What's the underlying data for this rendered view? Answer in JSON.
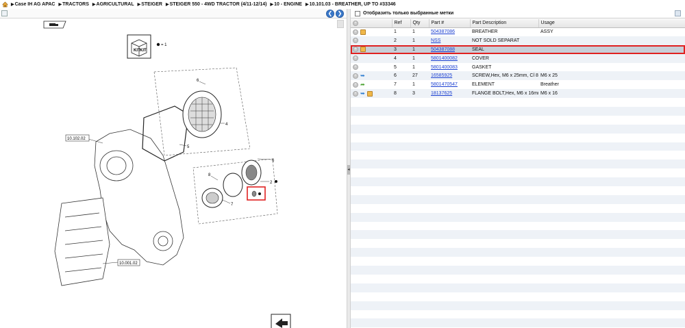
{
  "breadcrumb": {
    "items": [
      "Case IH AG APAC",
      "TRACTORS",
      "AGRICULTURAL",
      "STEIGER",
      "STEIGER 550 - 4WD TRACTOR (4/11-12/14)",
      "10 - ENGINE",
      "10.101.03 - BREATHER, UP TO #33346"
    ],
    "home_icon": "home-icon"
  },
  "diagram": {
    "kit_legend": "= 1",
    "kit_label": "KIT",
    "callouts": {
      "frame_1": "10.102.02",
      "frame_2": "10.001.02",
      "ref_2": "2",
      "ref_4": "4",
      "ref_5": "5",
      "ref_6a": "6",
      "ref_6b": "6",
      "ref_7": "7",
      "ref_8": "8"
    }
  },
  "filter": {
    "label": "Отобразить только выбранные метки"
  },
  "table": {
    "columns": [
      "Ref",
      "Qty",
      "Part #",
      "Part Description",
      "Usage"
    ],
    "rows": [
      {
        "ref": "1",
        "qty": "1",
        "part": "504387086",
        "desc": "BREATHER",
        "usage": "ASSY",
        "icons": [
          "box"
        ]
      },
      {
        "ref": "2",
        "qty": "1",
        "part": "NSS",
        "desc": "NOT SOLD SEPARAT",
        "usage": "",
        "icons": []
      },
      {
        "ref": "3",
        "qty": "1",
        "part": "504387088",
        "desc": "SEAL",
        "usage": "",
        "icons": [
          "box"
        ],
        "selected": true
      },
      {
        "ref": "4",
        "qty": "1",
        "part": "5801400082",
        "desc": "COVER",
        "usage": "",
        "icons": []
      },
      {
        "ref": "5",
        "qty": "1",
        "part": "5801400083",
        "desc": "GASKET",
        "usage": "",
        "icons": []
      },
      {
        "ref": "6",
        "qty": "27",
        "part": "16585925",
        "desc": "SCREW,Hex, M6 x 25mm, Cl 8.8",
        "usage": "M6 x 25",
        "icons": [
          "arrow-blue"
        ]
      },
      {
        "ref": "7",
        "qty": "1",
        "part": "5801470547",
        "desc": "ELEMENT",
        "usage": "Breather",
        "icons": [
          "arrow-green"
        ]
      },
      {
        "ref": "8",
        "qty": "3",
        "part": "18137625",
        "desc": "FLANGE BOLT,Hex, M6 x 16mm",
        "usage": "M6 x 16",
        "icons": [
          "arrow-blue",
          "box"
        ]
      }
    ]
  },
  "colors": {
    "selection_outline": "#e02020",
    "link": "#1a3fd1",
    "nav_button": "#3a78c9"
  }
}
